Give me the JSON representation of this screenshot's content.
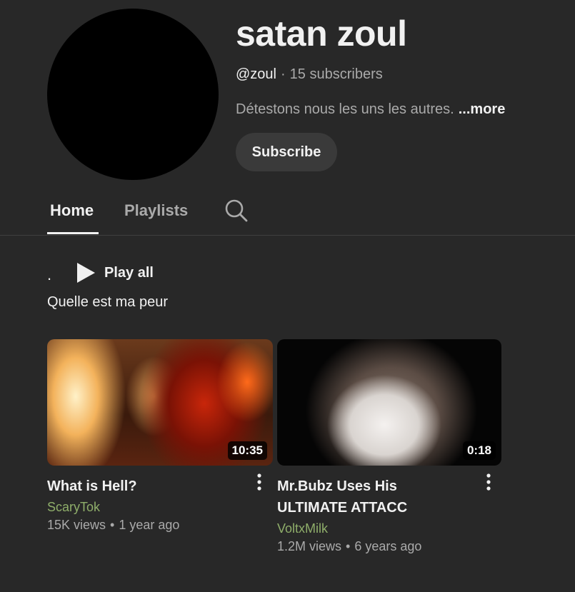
{
  "channel": {
    "name": "satan zoul",
    "handle": "@zoul",
    "separator": "·",
    "subscribers": "15 subscribers",
    "description": "Détestons nous les uns les autres.",
    "more_label": "...more",
    "subscribe_label": "Subscribe"
  },
  "tabs": {
    "items": [
      {
        "label": "Home",
        "active": true
      },
      {
        "label": "Playlists",
        "active": false
      }
    ],
    "search_icon": "search-icon"
  },
  "shelf": {
    "dot": ".",
    "play_all_label": "Play all",
    "title": "Quelle est ma peur"
  },
  "videos": [
    {
      "title": "What is Hell?",
      "duration": "10:35",
      "channel": "ScaryTok",
      "views": "15K views",
      "separator": "•",
      "age": "1 year ago"
    },
    {
      "title": "Mr.Bubz Uses His ULTIMATE ATTACC",
      "duration": "0:18",
      "channel": "VoltxMilk",
      "views": "1.2M views",
      "separator": "•",
      "age": "6 years ago"
    }
  ],
  "colors": {
    "background": "#282828",
    "text_primary": "#f1f1f1",
    "text_secondary": "#aaaaaa",
    "channel_link": "#8fae6a",
    "subscribe_bg": "#3a3a3a"
  }
}
